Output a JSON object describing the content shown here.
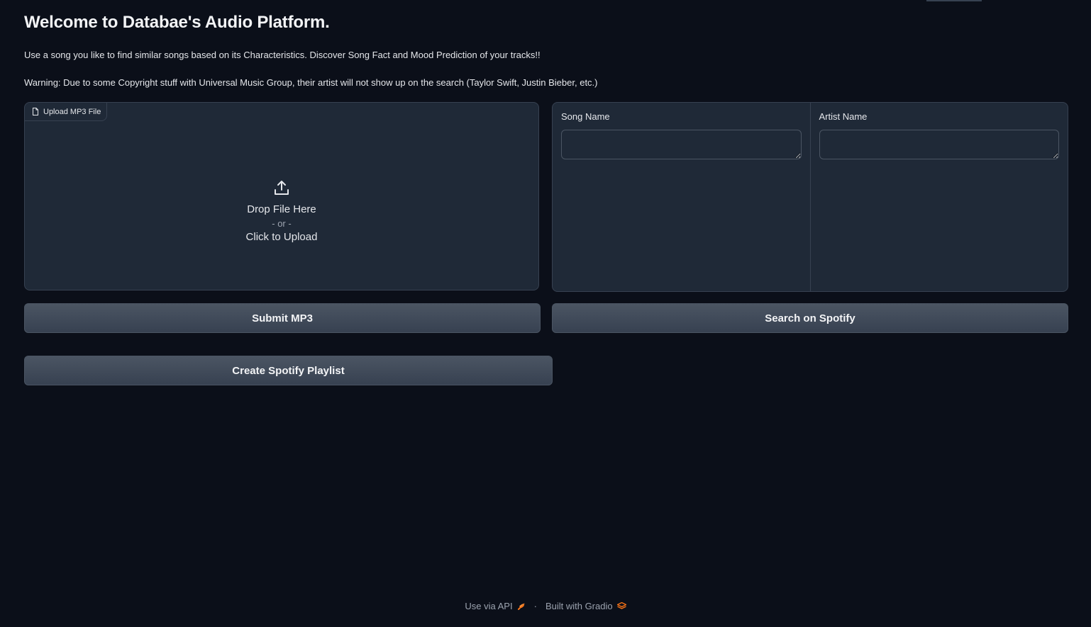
{
  "header": {
    "title": "Welcome to Databae's Audio Platform.",
    "description": "Use a song you like to find similar songs based on its Characteristics. Discover Song Fact and Mood Prediction of your tracks!!",
    "warning": "Warning: Due to some Copyright stuff with Universal Music Group, their artist will not show up on the search (Taylor Swift, Justin Bieber, etc.)"
  },
  "upload": {
    "label": "Upload MP3 File",
    "drop_text": "Drop File Here",
    "or_text": "- or -",
    "click_text": "Click to Upload"
  },
  "form": {
    "song_label": "Song Name",
    "song_value": "",
    "artist_label": "Artist Name",
    "artist_value": ""
  },
  "buttons": {
    "submit_mp3": "Submit MP3",
    "search_spotify": "Search on Spotify",
    "create_playlist": "Create Spotify Playlist"
  },
  "footer": {
    "api_text": "Use via API",
    "separator": "·",
    "built_text": "Built with Gradio"
  },
  "colors": {
    "background": "#0b0f19",
    "panel": "#1f2937",
    "border": "#374151",
    "button": "#4b5563",
    "accent": "#f97316"
  }
}
